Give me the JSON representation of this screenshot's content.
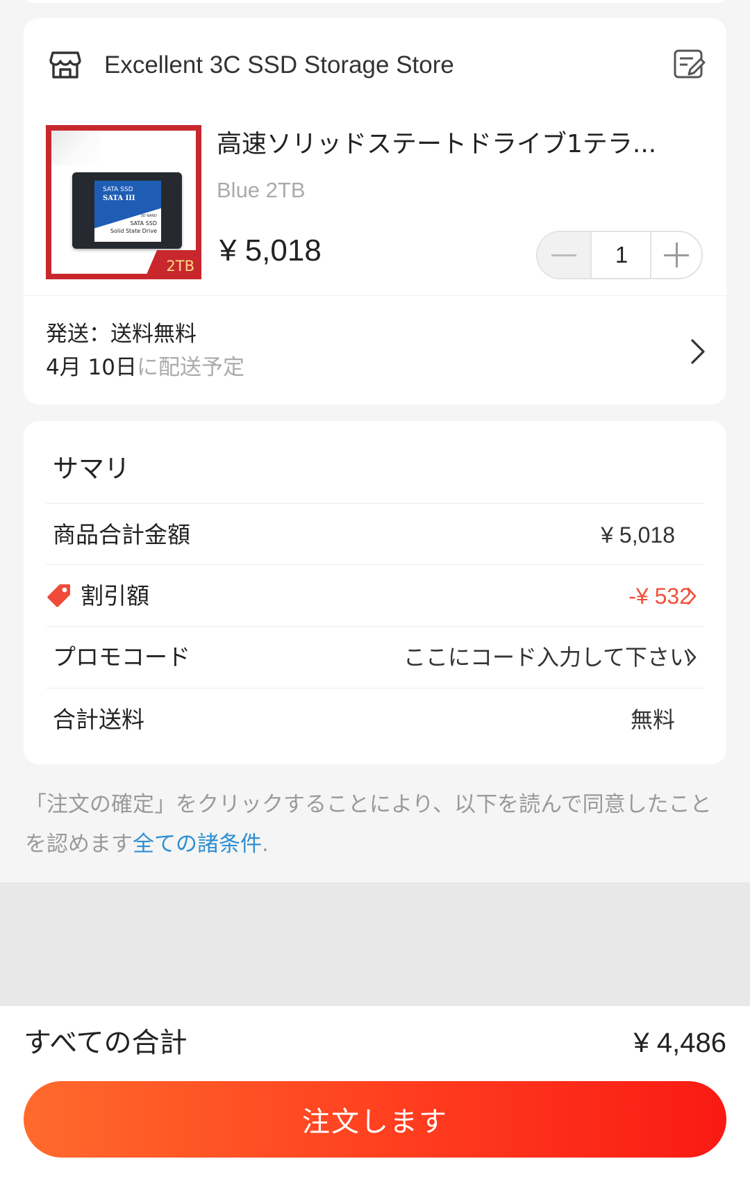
{
  "store": {
    "name": "Excellent 3C SSD Storage Store"
  },
  "product": {
    "title": "高速ソリッドステートドライブ1テラ...",
    "variant": "Blue 2TB",
    "price": "¥ 5,018",
    "quantity": "1",
    "image_text": {
      "line1": "SATA SSD",
      "line2": "SATA III",
      "line3": "3D NAND",
      "line4": "SATA SSD",
      "line5": "Solid State Drive",
      "badge": "2TB"
    }
  },
  "shipping": {
    "line1": "発送：送料無料",
    "date": "4月 10日",
    "suffix": "に配送予定"
  },
  "summary": {
    "title": "サマリ",
    "rows": [
      {
        "label": "商品合計金額",
        "value": "¥ 5,018"
      },
      {
        "label": "割引額",
        "value": "-¥ 532"
      },
      {
        "label": "プロモコード",
        "value": "ここにコード入力して下さい"
      },
      {
        "label": "合計送料",
        "value": "無料"
      }
    ]
  },
  "terms": {
    "text": "「注文の確定」をクリックすることにより、以下を読んで同意したことを認めます",
    "link": "全ての諸条件",
    "end": "."
  },
  "footer": {
    "total_label": "すべての合計",
    "total_value": "¥ 4,486",
    "order_button": "注文します"
  },
  "colors": {
    "accent": "#ff3d1f",
    "discount": "#f0513a",
    "link": "#2e8fd2"
  }
}
